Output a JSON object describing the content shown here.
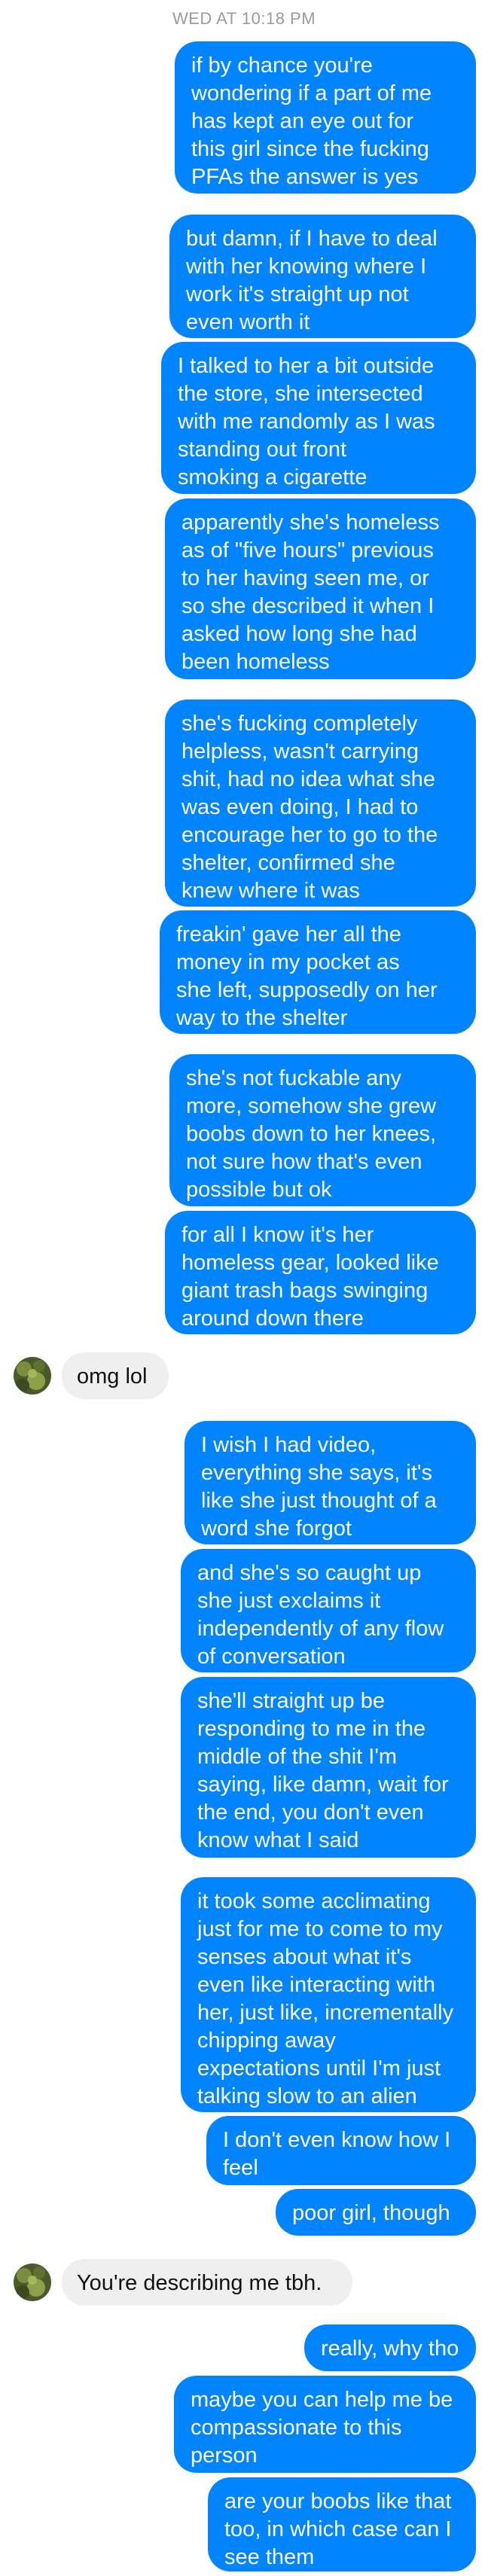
{
  "timestamp": "WED AT 10:18 PM",
  "colors": {
    "sent_bubble": "#0084ff",
    "received_bubble": "#efefef",
    "timestamp_text": "#9b9b9b"
  },
  "avatar_icon": "profile-photo-icon",
  "messages": [
    {
      "id": "m1",
      "from": "me",
      "text": "if by chance you're\nwondering if a part of me\nhas kept an eye out for\nthis girl since the fucking\nPFAs the answer is yes"
    },
    {
      "id": "m2",
      "from": "me",
      "text": "but damn, if I have to deal\nwith her knowing where I\nwork it's straight up not\neven worth it"
    },
    {
      "id": "m3",
      "from": "me",
      "text": "I talked to her a bit outside\nthe store, she intersected\nwith me randomly as I was\nstanding out front\nsmoking a cigarette"
    },
    {
      "id": "m4",
      "from": "me",
      "text": "apparently she's homeless\nas of \"five hours\" previous\nto her having seen me, or\nso she described it when I\nasked how long she had\nbeen homeless"
    },
    {
      "id": "m5",
      "from": "me",
      "text": "she's fucking completely\nhelpless, wasn't carrying\nshit, had no idea what she\nwas even doing, I had to\nencourage her to go to the\nshelter, confirmed she\nknew where it was"
    },
    {
      "id": "m6",
      "from": "me",
      "text": "freakin' gave her all the\nmoney in my pocket as\nshe left, supposedly on her\nway to the shelter"
    },
    {
      "id": "m7",
      "from": "me",
      "text": "she's not fuckable any\nmore, somehow she grew\nboobs down to her knees,\nnot sure how that's even\npossible but ok"
    },
    {
      "id": "m8",
      "from": "me",
      "text": "for all I know it's her\nhomeless gear, looked like\ngiant trash bags swinging\naround down there"
    },
    {
      "id": "m9",
      "from": "them",
      "text": "omg lol"
    },
    {
      "id": "m10",
      "from": "me",
      "text": "I wish I had video,\neverything she says, it's\nlike she just thought of a\nword she forgot"
    },
    {
      "id": "m11",
      "from": "me",
      "text": "and she's so caught up\nshe just exclaims it\nindependently of any flow\nof conversation"
    },
    {
      "id": "m12",
      "from": "me",
      "text": "she'll straight up be\nresponding to me in the\nmiddle of the shit I'm\nsaying, like damn, wait for\nthe end, you don't even\nknow what I said"
    },
    {
      "id": "m13",
      "from": "me",
      "text": "it took some acclimating\njust for me to come to my\nsenses about what it's\neven like interacting with\nher, just like, incrementally\nchipping away\nexpectations until I'm just\ntalking slow to an alien"
    },
    {
      "id": "m14",
      "from": "me",
      "text": "I don't even know how I\nfeel"
    },
    {
      "id": "m15",
      "from": "me",
      "text": "poor girl, though"
    },
    {
      "id": "m16",
      "from": "them",
      "text": "You're describing me tbh."
    },
    {
      "id": "m17",
      "from": "me",
      "text": "really, why tho"
    },
    {
      "id": "m18",
      "from": "me",
      "text": "maybe you can help me be\ncompassionate to this\nperson"
    },
    {
      "id": "m19",
      "from": "me",
      "text": "are your boobs like that\ntoo, in which case can I\nsee them"
    }
  ]
}
